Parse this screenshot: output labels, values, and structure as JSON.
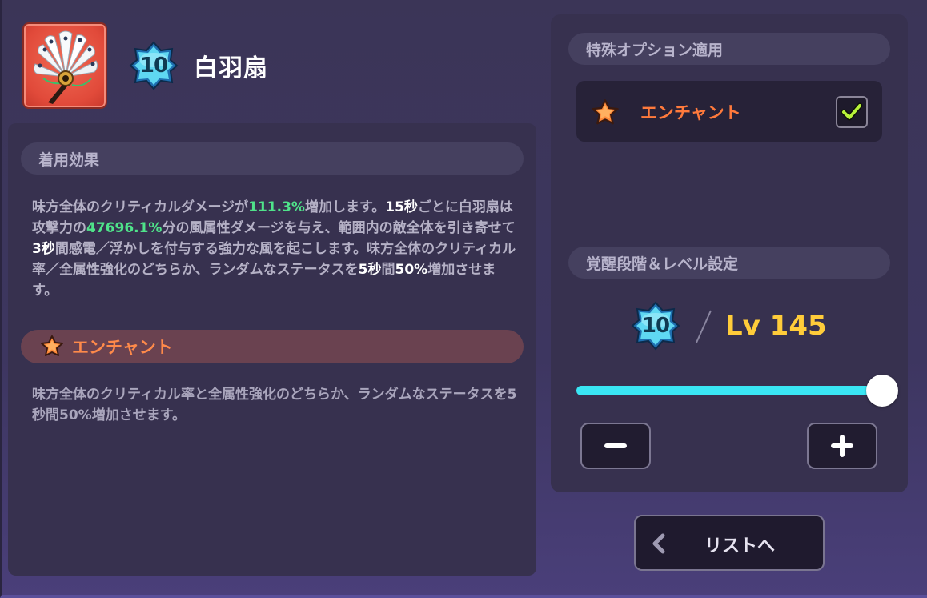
{
  "item": {
    "name": "白羽扇",
    "awakening": "10"
  },
  "equip_effect": {
    "header": "着用効果",
    "description": [
      {
        "t": "味方全体のクリティカルダメージが",
        "c": ""
      },
      {
        "t": "111.3%",
        "c": "green"
      },
      {
        "t": "増加します。",
        "c": ""
      },
      {
        "t": "15秒",
        "c": "white"
      },
      {
        "t": "ごとに白羽扇は攻撃力の",
        "c": ""
      },
      {
        "t": "47696.1%",
        "c": "green"
      },
      {
        "t": "分の風属性ダメージを与え、範囲内の敵全体を引き寄せて",
        "c": ""
      },
      {
        "t": "3秒",
        "c": "white"
      },
      {
        "t": "間感電／浮かしを付与する強力な風を起こします。味方全体のクリティカル率／全属性強化のどちらか、ランダムなステータスを",
        "c": ""
      },
      {
        "t": "5秒",
        "c": "white"
      },
      {
        "t": "間",
        "c": ""
      },
      {
        "t": "50%",
        "c": "white"
      },
      {
        "t": "増加させます。",
        "c": ""
      }
    ]
  },
  "enchant": {
    "label": "エンチャント",
    "description": "味方全体のクリティカル率と全属性強化のどちらか、ランダムなステータスを5秒間50%増加させます。"
  },
  "special_option": {
    "header": "特殊オプション適用",
    "option_label": "エンチャント",
    "checked": true
  },
  "awaken_settings": {
    "header": "覚醒段階＆レベル設定",
    "awakening": "10",
    "level_text": "Lv 145",
    "slider_fraction": 1.0
  },
  "buttons": {
    "minus": "−",
    "plus": "+",
    "list": "リストへ"
  },
  "colors": {
    "accent_cyan": "#3ae6f4",
    "level_gold": "#ffcc3a",
    "enchant_orange": "#ff7a3c",
    "highlight_green": "#4fe38a",
    "check_green": "#b8f23a"
  }
}
